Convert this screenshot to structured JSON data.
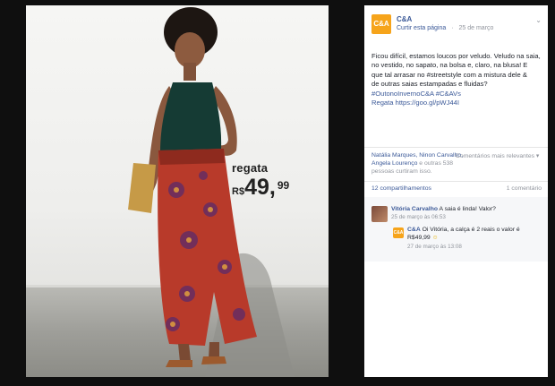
{
  "photo": {
    "price_label": "regata",
    "price_currency": "R$",
    "price_main": "49,",
    "price_cents": "99"
  },
  "post": {
    "page_name": "C&A",
    "logo_text": "C&A",
    "like_page": "Curtir esta página",
    "date": "25 de março",
    "text_line1": "Ficou difícil, estamos loucos por veludo. Veludo na saia,",
    "text_line2": "no vestido, no sapato, na bolsa e, claro, na blusa! E",
    "text_line3": "que tal arrasar no #streetstyle com a mistura dele &",
    "text_line4": "de outras saias estampadas e fluidas?",
    "text_line5": "#OutonoInvernoC&A #C&AVs",
    "text_line6": "Regata https://goo.gl/pWJ44I"
  },
  "reactions": {
    "names": "Natália Marques, Ninon Carvalho, Angela Lourenço",
    "others": "e outras 538 pessoas curtiram isso.",
    "sort": "Comentários mais relevantes",
    "comments_count": "12 compartilhamentos",
    "comments_right": "1 comentário"
  },
  "comments": [
    {
      "author": "Vitória Carvalho",
      "text": "A saia é linda! Valor?",
      "time": "25 de março às 06:53"
    },
    {
      "author": "C&A",
      "text": "Oi Vitória, a calça é 2 reais o valor é R$49,99",
      "time": "27 de março às 13:08",
      "emoji": "☺"
    }
  ]
}
